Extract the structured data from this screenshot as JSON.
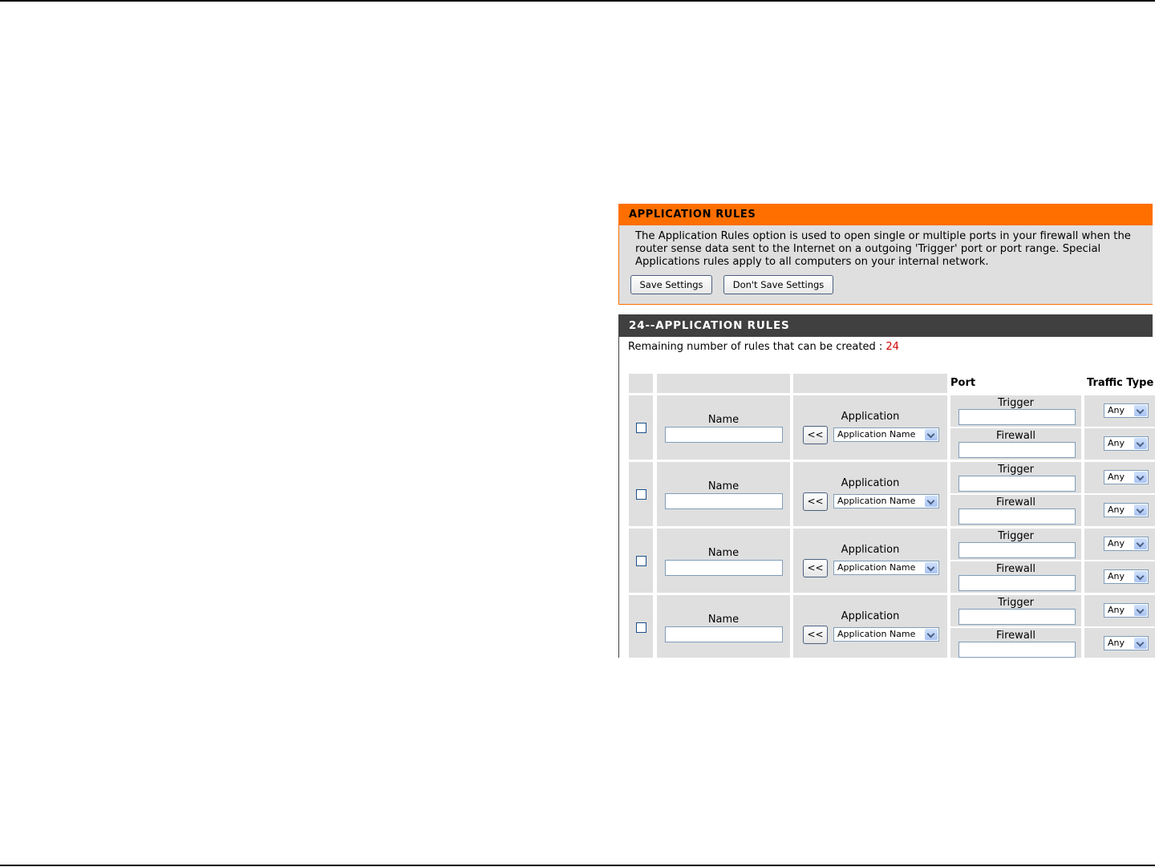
{
  "application_rules": {
    "title": "APPLICATION RULES",
    "description": "The Application Rules option is used to open single or multiple ports in your firewall when the router sense data sent to the Internet on a outgoing 'Trigger' port or port range. Special Applications rules apply to all computers on your internal network.",
    "save_label": "Save Settings",
    "dont_save_label": "Don't Save Settings"
  },
  "rules_section": {
    "title": "24--APPLICATION RULES",
    "remaining_text": "Remaining number of rules that can be created : ",
    "remaining_count": "24",
    "headers": {
      "port": "Port",
      "traffic_type": "Traffic Type"
    },
    "labels": {
      "name": "Name",
      "application": "Application",
      "trigger": "Trigger",
      "firewall": "Firewall",
      "arrow_button": "<<",
      "application_select": "Application Name",
      "traffic_select": "Any"
    }
  },
  "colors": {
    "orange_header": "#ff6f00",
    "dark_header": "#404040",
    "cell_bg": "#dfdfdf",
    "count_red": "#d20000"
  }
}
